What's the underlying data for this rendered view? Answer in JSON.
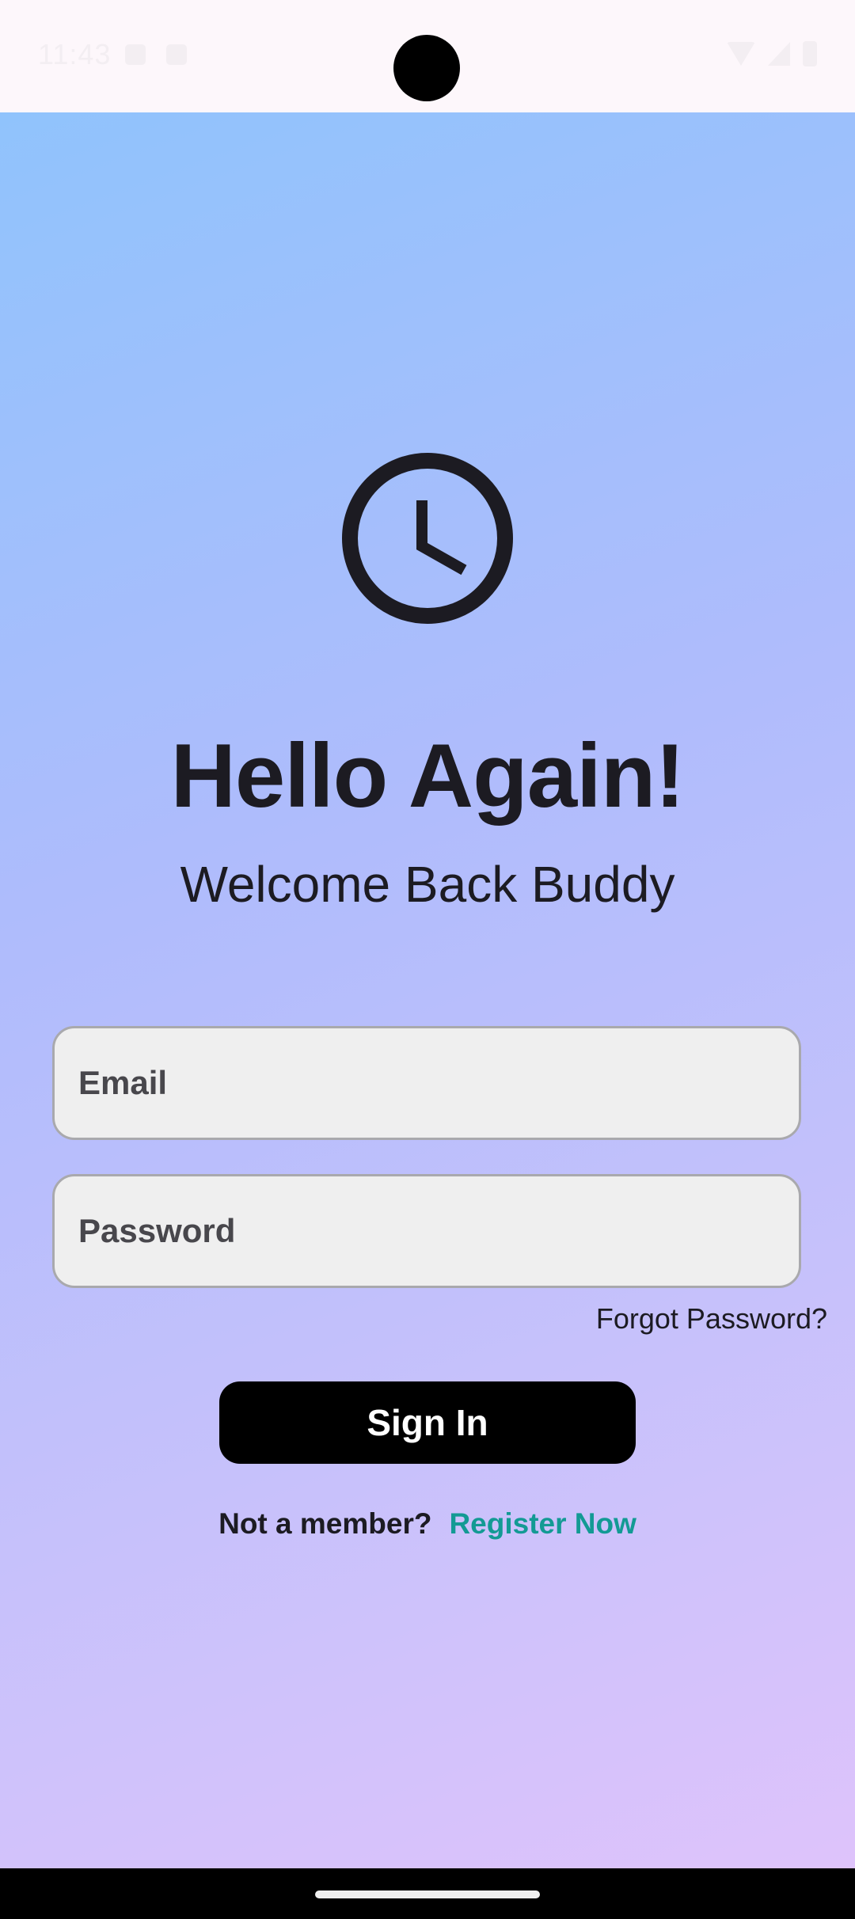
{
  "status_bar": {
    "time": "11:43",
    "left_icons": [
      "notification-icon",
      "sd-card-icon"
    ],
    "right_icons": [
      "wifi-icon",
      "signal-icon",
      "battery-icon"
    ]
  },
  "logo": {
    "icon": "clock-icon",
    "color": "#1c1b22"
  },
  "header": {
    "title": "Hello Again!",
    "subtitle": "Welcome Back Buddy"
  },
  "form": {
    "email_placeholder": "Email",
    "password_placeholder": "Password",
    "forgot_label": "Forgot Password?",
    "signin_label": "Sign In"
  },
  "footer": {
    "prompt": "Not a member?",
    "register_label": "Register Now",
    "register_color": "#139a94"
  },
  "colors": {
    "gradient_start": "#90c3fc",
    "gradient_end": "#dec3fb",
    "button": "#000000"
  }
}
